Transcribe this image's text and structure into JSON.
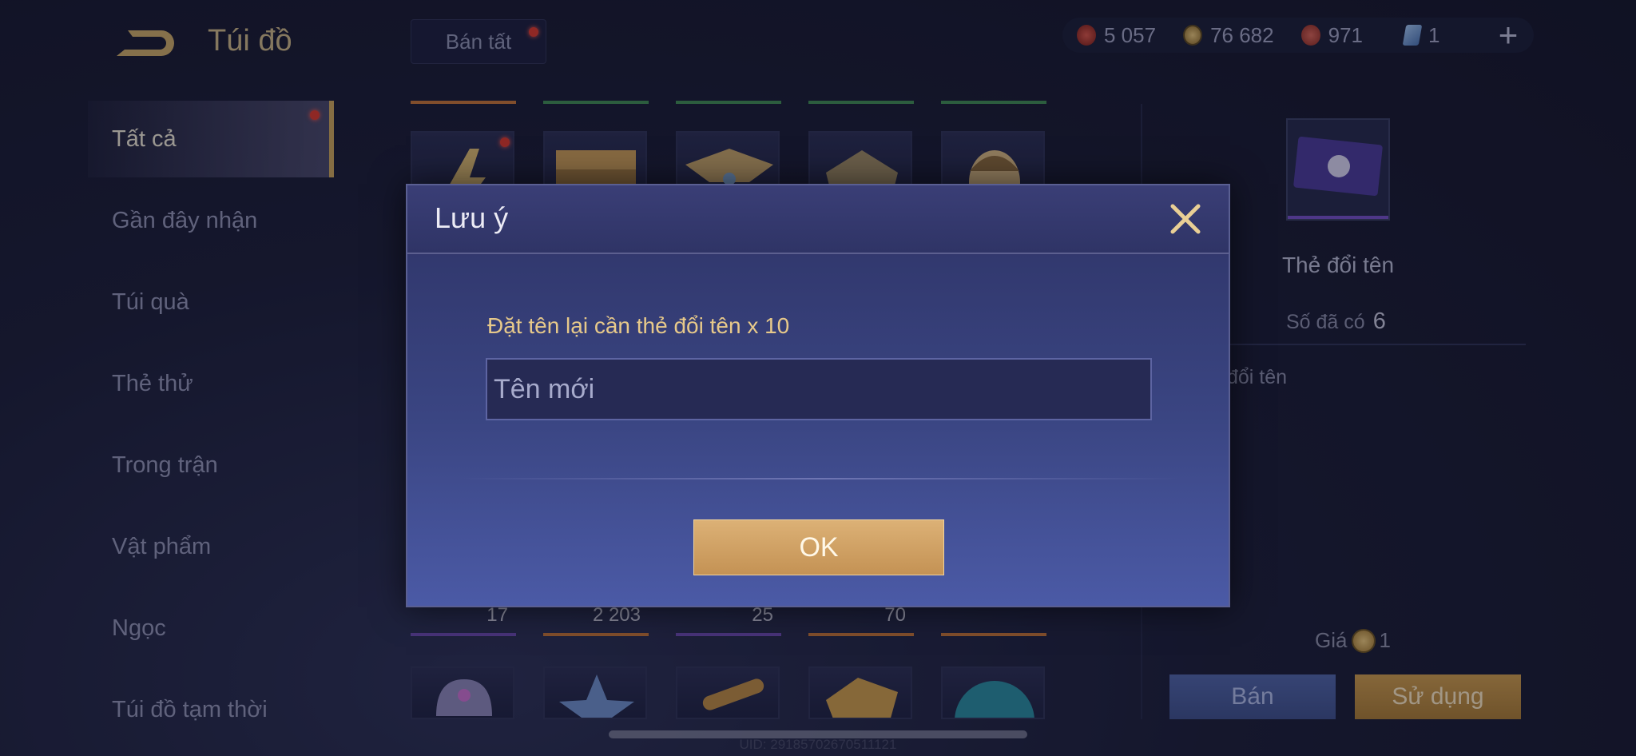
{
  "header": {
    "title": "Túi đồ",
    "sell_all_label": "Bán tất"
  },
  "currencies": [
    {
      "icon": "red-gem-icon",
      "value": "5 057",
      "color": "#c0392b"
    },
    {
      "icon": "gold-coin-icon",
      "value": "76 682",
      "color": "#c9a25a"
    },
    {
      "icon": "red-crystal-icon",
      "value": "971",
      "color": "#b5453b"
    },
    {
      "icon": "blue-card-icon",
      "value": "1",
      "color": "#6f9fd8"
    }
  ],
  "sidebar": {
    "items": [
      {
        "label": "Tất cả",
        "active": true
      },
      {
        "label": "Gần đây nhận"
      },
      {
        "label": "Túi quà"
      },
      {
        "label": "Thẻ thử"
      },
      {
        "label": "Trong trận"
      },
      {
        "label": "Vật phẩm"
      },
      {
        "label": "Ngọc"
      },
      {
        "label": "Túi đồ tạm thời"
      }
    ]
  },
  "grid": {
    "row_counts": [
      "17",
      "2 203",
      "25",
      "70",
      ""
    ]
  },
  "detail": {
    "item_name": "Thẻ đổi tên",
    "owned_label": "Số đã có",
    "owned_value": "6",
    "description": "đổi tên",
    "price_label": "Giá",
    "price_value": "1",
    "sell_label": "Bán",
    "use_label": "Sử dụng"
  },
  "footer": {
    "uid": "UID: 29185702670511121"
  },
  "dialog": {
    "title": "Lưu ý",
    "hint": "Đặt tên lại cần thẻ đổi tên x 10",
    "input_placeholder": "Tên mới",
    "input_value": "",
    "ok_label": "OK"
  }
}
